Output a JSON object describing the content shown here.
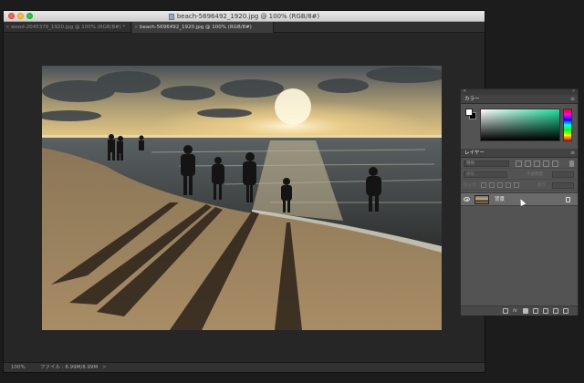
{
  "window": {
    "title": "beach-5696492_1920.jpg @ 100% (RGB/8#)"
  },
  "tabs": [
    {
      "label": "wood-2045379_1920.jpg @ 100% (RGB/8#) *",
      "active": false
    },
    {
      "label": "beach-5696492_1920.jpg @ 100% (RGB/8#)",
      "active": true
    }
  ],
  "status": {
    "zoom": "100%",
    "file_info": "ファイル : 8.99M/8.99M",
    "arrow": ">"
  },
  "color_panel": {
    "title": "カラー",
    "foreground": "#ffffff",
    "background": "#000000",
    "picker_hue": "#1fe0a0"
  },
  "layers_panel": {
    "title": "レイヤー",
    "search_placeholder": "種類",
    "blend_mode": "通常",
    "opacity_label": "不透明度",
    "lock_label": "ロック",
    "fill_label": "塗り",
    "layers": [
      {
        "name": "背景",
        "visible": true,
        "locked": true
      }
    ]
  },
  "icons": {
    "close": "close-icon",
    "collapse": "double-chevron-icon",
    "menu": "panel-menu-icon"
  }
}
